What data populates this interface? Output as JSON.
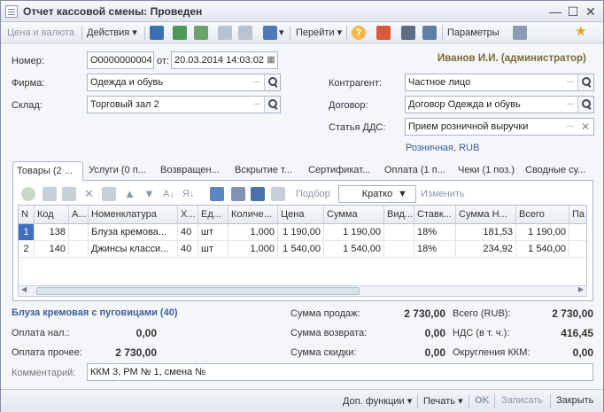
{
  "window": {
    "title": "Отчет кассовой смены: Проведен"
  },
  "toolbar": {
    "price_currency": "Цена и валюта",
    "actions": "Действия",
    "goto": "Перейти",
    "help": "?",
    "parameters": "Параметры"
  },
  "header": {
    "number_label": "Номер:",
    "number_value": "О0000000004",
    "from_label": "от:",
    "date_value": "20.03.2014 14:03:02",
    "user": "Иванов И.И. (администратор)",
    "firm_label": "Фирма:",
    "firm_value": "Одежда и обувь",
    "warehouse_label": "Склад:",
    "warehouse_value": "Торговый зал 2",
    "counterparty_label": "Контрагент:",
    "counterparty_value": "Частное лицо",
    "contract_label": "Договор:",
    "contract_value": "Договор Одежда и обувь",
    "dds_label": "Статья ДДС:",
    "dds_value": "Прием розничной выручки",
    "price_type_link": "Розничная, RUB"
  },
  "tabs": [
    {
      "label": "Товары (2 ..."
    },
    {
      "label": "Услуги (0 п..."
    },
    {
      "label": "Возвращен..."
    },
    {
      "label": "Вскрытие т..."
    },
    {
      "label": "Сертификат..."
    },
    {
      "label": "Оплата (1 п..."
    },
    {
      "label": "Чеки (1 поз.)"
    },
    {
      "label": "Сводные су..."
    }
  ],
  "table_toolbar": {
    "select": "Подбор",
    "mode": "Кратко",
    "change": "Изменить"
  },
  "table": {
    "columns": [
      "N",
      "Код",
      "А...",
      "Номенклатура",
      "Х...",
      "Ед...",
      "Количе...",
      "Цена",
      "Сумма",
      "Вид...",
      "Ставк...",
      "Сумма Н...",
      "Всего",
      "Па"
    ],
    "rows": [
      {
        "n": "1",
        "code": "138",
        "a": "",
        "name": "Блуза кремова...",
        "x": "40",
        "unit": "шт",
        "qty": "1,000",
        "price": "1 190,00",
        "sum": "1 190,00",
        "kind": "",
        "rate": "18%",
        "vat": "181,53",
        "total": "1 190,00",
        "pa": ""
      },
      {
        "n": "2",
        "code": "140",
        "a": "",
        "name": "Джинсы класси...",
        "x": "40",
        "unit": "шт",
        "qty": "1,000",
        "price": "1 540,00",
        "sum": "1 540,00",
        "kind": "",
        "rate": "18%",
        "vat": "234,92",
        "total": "1 540,00",
        "pa": ""
      }
    ]
  },
  "summary": {
    "selected_item": "Блуза кремовая с пуговицами (40)",
    "cash_label": "Оплата нал.:",
    "cash_value": "0,00",
    "other_label": "Оплата прочее:",
    "other_value": "2 730,00",
    "sales_label": "Сумма продаж:",
    "sales_value": "2 730,00",
    "return_label": "Сумма возврата:",
    "return_value": "0,00",
    "discount_label": "Сумма скидки:",
    "discount_value": "0,00",
    "total_label": "Всего (RUB):",
    "total_value": "2 730,00",
    "vat_label": "НДС (в т. ч.):",
    "vat_value": "416,45",
    "rounding_label": "Округления ККМ:",
    "rounding_value": "0,00",
    "comment_label": "Комментарий:",
    "comment_value": "ККМ 3, РМ № 1, смена №"
  },
  "bottom": {
    "extra": "Доп. функции",
    "print": "Печать",
    "ok": "OK",
    "save": "Записать",
    "close": "Закрыть"
  },
  "colors": {
    "accent_link": "#3c5f9e",
    "user_color": "#7a6a37",
    "selection": "#3f6fc2"
  }
}
